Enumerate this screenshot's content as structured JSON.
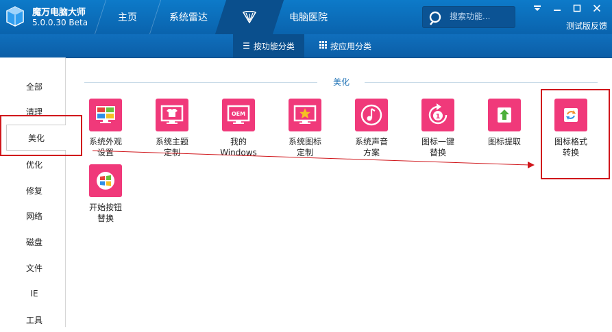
{
  "app": {
    "name": "魔万电脑大师",
    "version": "5.0.0.30 Beta"
  },
  "nav": {
    "home": "主页",
    "radar": "系统雷达",
    "hospital": "电脑医院"
  },
  "search": {
    "placeholder": "搜索功能..."
  },
  "header": {
    "feedback": "测试版反馈"
  },
  "subnav": {
    "by_function": "按功能分类",
    "by_app": "按应用分类"
  },
  "sidebar": {
    "items": [
      "全部",
      "清理",
      "美化",
      "优化",
      "修复",
      "网络",
      "磁盘",
      "文件",
      "IE",
      "工具"
    ],
    "active": "美化"
  },
  "section": {
    "title": "美化"
  },
  "tools": [
    {
      "label": "系统外观\n设置",
      "icon": "windows-appearance-icon"
    },
    {
      "label": "系统主题\n定制",
      "icon": "tshirt-monitor-icon"
    },
    {
      "label": "我的\nWindows",
      "icon": "oem-monitor-icon",
      "icon_text": "OEM"
    },
    {
      "label": "系统图标\n定制",
      "icon": "star-monitor-icon"
    },
    {
      "label": "系统声音\n方案",
      "icon": "music-note-icon"
    },
    {
      "label": "图标一键\n替换",
      "icon": "refresh-one-icon",
      "icon_text": "1"
    },
    {
      "label": "图标提取",
      "icon": "upload-arrow-icon"
    },
    {
      "label": "图标格式\n转换",
      "icon": "convert-icon"
    },
    {
      "label": "开始按钮\n替换",
      "icon": "windows-start-icon"
    }
  ],
  "colors": {
    "titlebar": "#0a63ad",
    "accent_pink": "#f0397a",
    "highlight_red": "#d0161b",
    "section_blue": "#1a6fb4"
  }
}
